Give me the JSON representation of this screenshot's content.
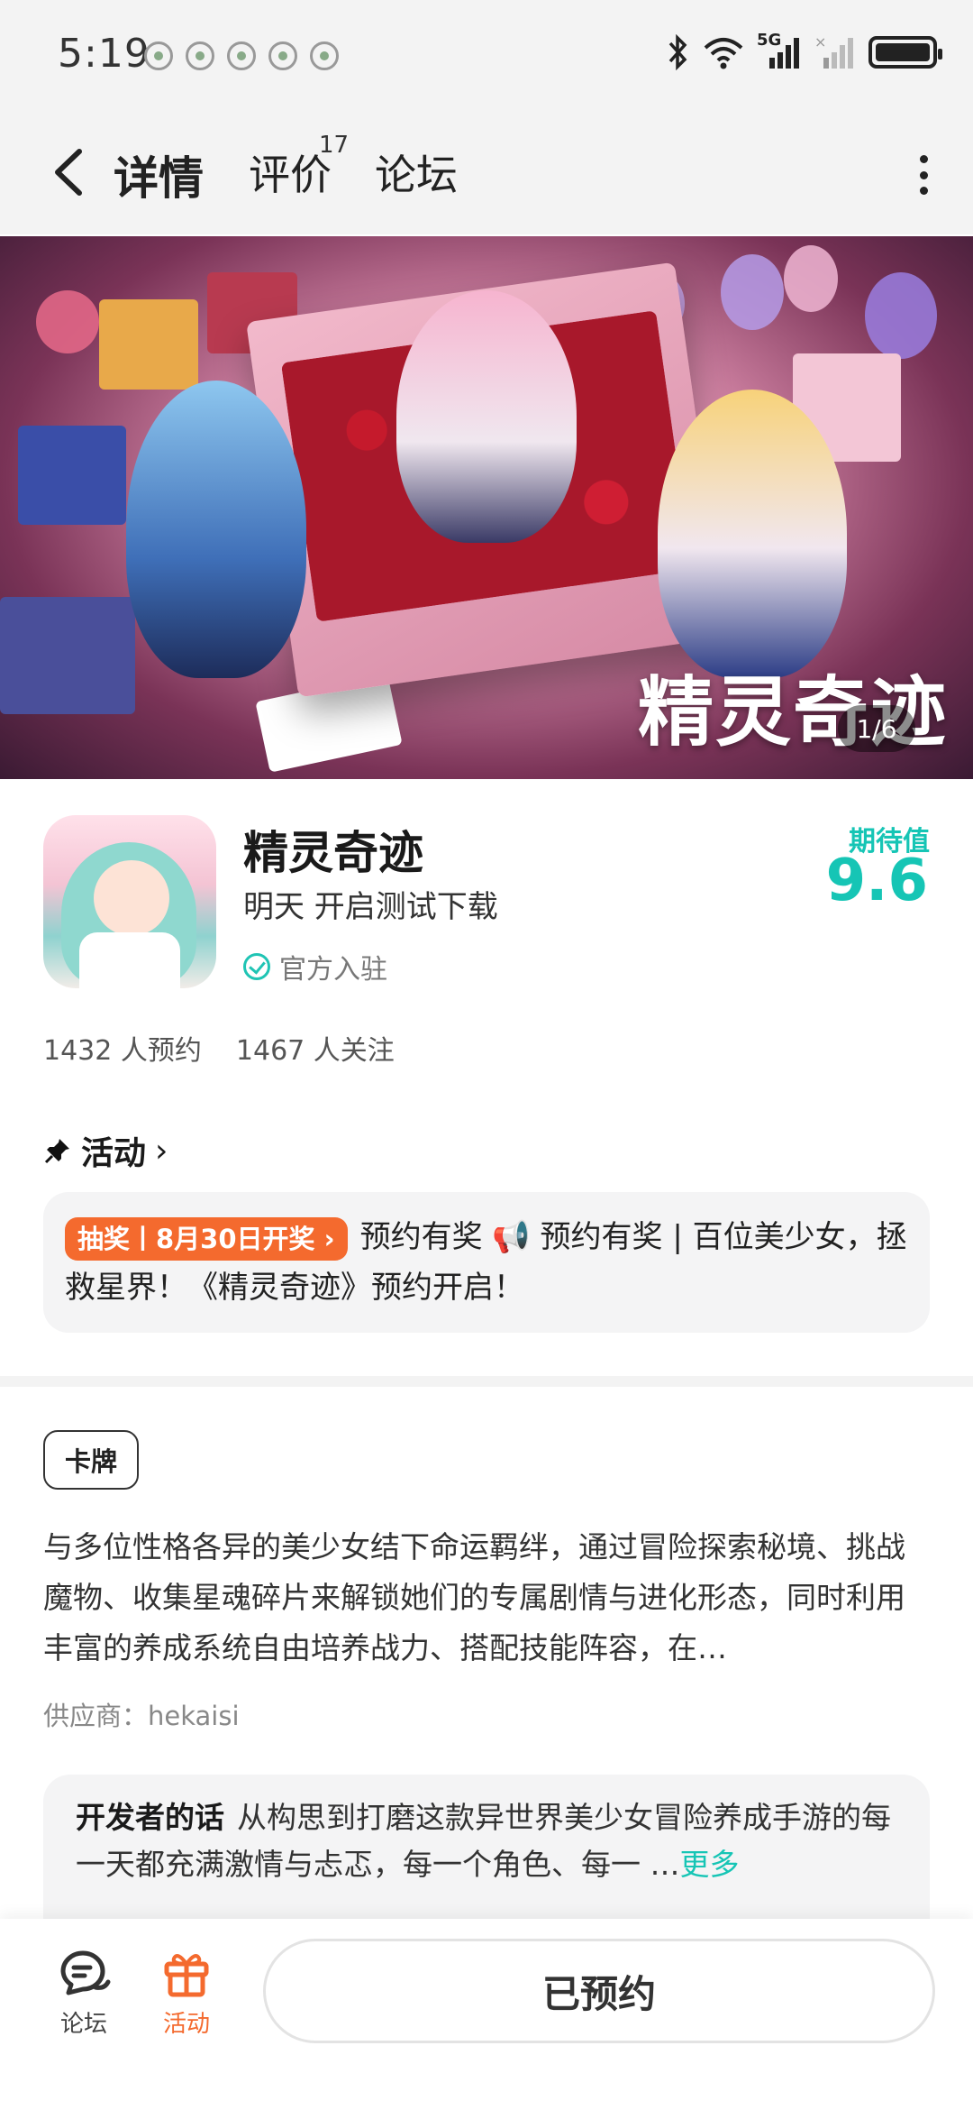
{
  "status_bar": {
    "time": "5:19",
    "network": "5G"
  },
  "header": {
    "tabs": [
      {
        "label": "详情",
        "active": true
      },
      {
        "label": "评价",
        "badge": "17"
      },
      {
        "label": "论坛"
      }
    ]
  },
  "banner": {
    "logo_text": "精灵奇迹",
    "counter": "1/6"
  },
  "app": {
    "title": "精灵奇迹",
    "subtitle": "明天 开启测试下载",
    "official_label": "官方入驻",
    "expect_label": "期待值",
    "expect_value": "9.6",
    "accent_color": "#16c5b5",
    "stats": {
      "reservations": "1432 人预约",
      "followers": "1467 人关注"
    }
  },
  "activity": {
    "header": "活动",
    "tag": "抽奖丨8月30日开奖 ›",
    "text": "预约有奖 📢 预约有奖 | 百位美少女，拯救星界！《精灵奇迹》预约开启！",
    "tag_color": "#f46a2e"
  },
  "details": {
    "genre": "卡牌",
    "description": "与多位性格各异的美少女结下命运羁绊，通过冒险探索秘境、挑战魔物、收集星魂碎片来解锁她们的专属剧情与进化形态，同时利用丰富的养成系统自由培养战力、搭配技能阵容，在…",
    "supplier": "供应商：hekaisi",
    "developer_label": "开发者的话",
    "developer_text": "从构思到打磨这款异世界美少女冒险养成手游的每一天都充满激情与忐忑，每一个角色、每一 …",
    "more_label": "更多"
  },
  "bottom_bar": {
    "forum_label": "论坛",
    "activity_label": "活动",
    "reserve_button": "已预约"
  }
}
